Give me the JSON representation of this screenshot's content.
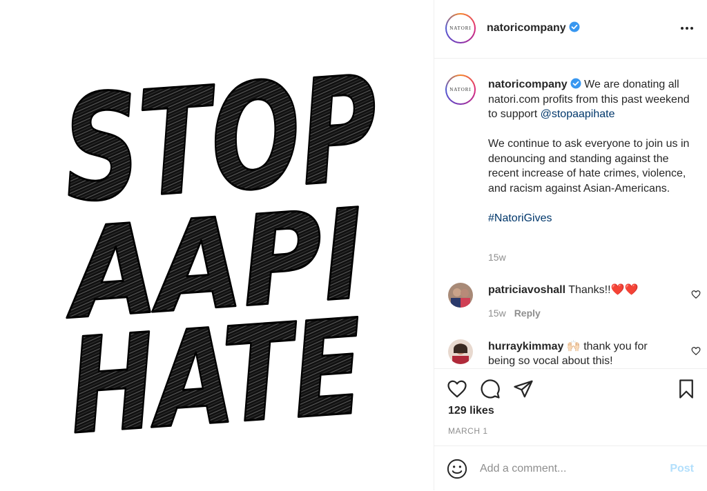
{
  "post": {
    "image": {
      "lines": [
        "STOP",
        "AAPI",
        "HATE"
      ]
    },
    "header": {
      "avatar_text": "NATORI",
      "username": "natoricompany",
      "verified": true,
      "more_icon": "more-horizontal-icon"
    },
    "caption": {
      "username": "natoricompany",
      "text_before_mention": " We are donating all natori.com profits from this past weekend to support ",
      "mention": "@stopaapihate",
      "paragraph2": "We continue to ask everyone to join us in denouncing and standing against the recent increase of hate crimes, violence, and racism against Asian-Americans.",
      "hashtag": "#NatoriGives",
      "time": "15w"
    },
    "comments": [
      {
        "username": "patriciavoshall",
        "text": "Thanks!!",
        "emoji": "❤️❤️",
        "time": "15w",
        "reply_label": "Reply"
      },
      {
        "username": "hurraykimmay",
        "emoji": "🙌🏻",
        "text": " thank you for being so vocal about this!"
      }
    ],
    "actions": {
      "like_icon": "heart-icon",
      "comment_icon": "comment-icon",
      "share_icon": "share-icon",
      "save_icon": "bookmark-icon"
    },
    "likes": "129 likes",
    "date": "MARCH 1",
    "comment_box": {
      "emoji_icon": "emoji-icon",
      "placeholder": "Add a comment...",
      "post_label": "Post"
    },
    "colors": {
      "link": "#00376b",
      "muted": "#8e8e8e",
      "post_disabled": "#b2dffc",
      "verified": "#3897f0"
    }
  }
}
